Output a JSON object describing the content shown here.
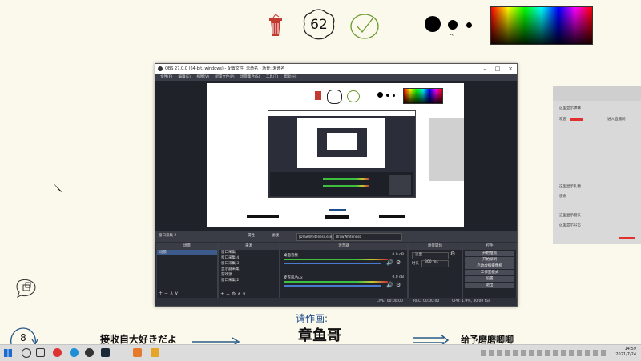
{
  "whiteboard": {
    "counter_value": "62",
    "bottom_counter_value": "8",
    "request_label": "请作画:",
    "subject_name": "章鱼哥",
    "receive_text": "接收自大好きだよ",
    "give_text": "给予磨磨唧唧"
  },
  "obs": {
    "title": "OBS 27.0.0 (64-bit, windows) - 配置文件: 未命名 - 场景: 未命名",
    "menu": [
      "文件(F)",
      "编辑(E)",
      "视图(V)",
      "配置文件(P)",
      "场景集合(S)",
      "工具(T)",
      "帮助(H)"
    ],
    "scene_bar_label": "窗口采集 2",
    "scene_bar_buttons": [
      "属性",
      "滤镜"
    ],
    "scene_bar_fields": [
      "[DrawWhiteness.exe]",
      "DrawWhiteness"
    ],
    "panels": {
      "scenes_title": "场景",
      "scenes": [
        "场景"
      ],
      "sources_title": "来源",
      "sources": [
        "窗口采集",
        "窗口采集 4",
        "窗口采集 3",
        "显示器采集",
        "游戏源",
        "窗口采集 2"
      ],
      "mixer_title": "混音器",
      "mixer_tracks": [
        {
          "name": "桌面音频",
          "db": "0.0 dB"
        },
        {
          "name": "麦克风/Aux",
          "db": "0.0 dB"
        }
      ],
      "transitions_title": "场景转场",
      "transition_type": "淡出",
      "duration_label": "时长",
      "duration_value": "300 ms",
      "controls_title": "控件",
      "controls": [
        "开始推流",
        "开始录制",
        "启动虚拟摄像机",
        "工作室模式",
        "设置",
        "退出"
      ]
    },
    "status": {
      "live": "LIVE: 00:00:00",
      "rec": "REC: 00:00:00",
      "cpu": "CPU: 1.9%, 30.00 fps"
    }
  },
  "dock": {
    "lines": [
      "这里显示弹幕",
      "欢迎",
      "进入直播间",
      "这里显示礼物",
      "感谢",
      "这里显示舰长",
      "这里显示公告"
    ],
    "highlight_color": "#e03030"
  },
  "taskbar": {
    "time": "14:59",
    "date": "2021/7/24"
  }
}
